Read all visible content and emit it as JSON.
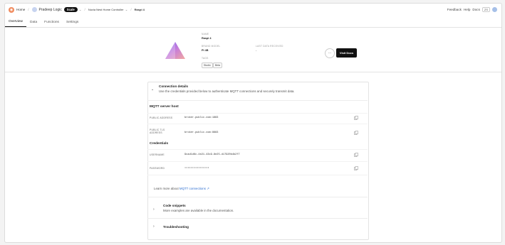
{
  "topbar": {
    "home_label": "Home",
    "workspace": "Pradeep Logic",
    "plan_badge": "Scale",
    "project": "Nuvia Nest Home Controller",
    "device": "Raspi 4",
    "feedback": "Feedback",
    "help": "Help",
    "docs": "Docs",
    "user_box": "ZS"
  },
  "tabs": [
    {
      "label": "Overview"
    },
    {
      "label": "Data"
    },
    {
      "label": "Functions"
    },
    {
      "label": "Settings"
    }
  ],
  "device": {
    "name_label": "NAME",
    "name_value": "Raspi 4",
    "brand_label": "BRAND MODEL",
    "brand_value": "Pi 4B",
    "last_label": "LAST DATA RECEIVED",
    "last_value": "-",
    "tags_label": "TAGS",
    "tags": [
      "Studio",
      "Beta"
    ],
    "more_button": "···",
    "visit_button": "Visit Docs"
  },
  "connection": {
    "title": "Connection details",
    "description": "Use the credentials provided below to authenticate MQTT connections and securely transmit data.",
    "mqtt_heading": "MQTT server host",
    "public_address_label": "PUBLIC ADDRESS",
    "public_address_value": "broker.public.com:1883",
    "public_tls_label_1": "PUBLIC TLS",
    "public_tls_label_2": "ADDRESS",
    "public_tls_value": "broker.public.com:8883",
    "credentials_heading": "Credentials",
    "username_label": "USERNAME",
    "username_value": "9cad1d6c-4e21-43c9-8e25-d17920b4b2f7",
    "password_label": "PASSWORD",
    "password_value": "••••••••••••••••",
    "learn_prefix": "Learn more about",
    "learn_link": "MQTT connections"
  },
  "snippets": {
    "title": "Code snippets",
    "description": "More examples are available in the documentation."
  },
  "troubleshooting": {
    "title": "Troubleshooting"
  },
  "colors": {
    "accent": "#111111",
    "link": "#2f6fd0",
    "home_logo": "#f08a5d"
  }
}
